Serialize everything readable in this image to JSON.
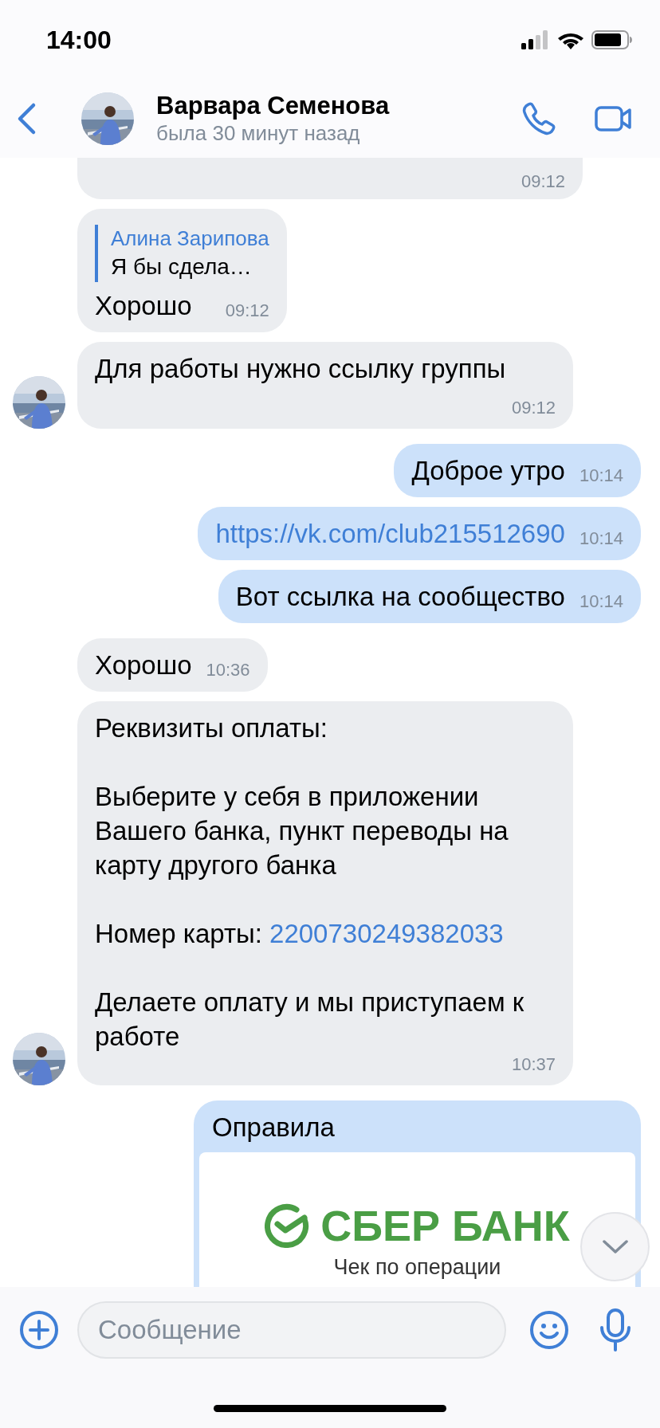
{
  "status_bar": {
    "time": "14:00"
  },
  "header": {
    "name": "Варвара Семенова",
    "status": "была 30 минут назад"
  },
  "messages": [
    {
      "outgoing": false,
      "kind": "text",
      "avatar": false,
      "time": "09:12"
    },
    {
      "outgoing": false,
      "kind": "reply",
      "avatar": false,
      "quote_author": "Алина Зарипова",
      "quote_text": "Я бы сдела…",
      "text": "Хорошо",
      "time": "09:12"
    },
    {
      "outgoing": false,
      "kind": "text",
      "avatar": true,
      "text": "Для работы нужно ссылку группы",
      "time": "09:12"
    },
    {
      "outgoing": true,
      "kind": "text",
      "text": "Доброе утро",
      "time": "10:14"
    },
    {
      "outgoing": true,
      "kind": "link",
      "text": "https://vk.com/club215512690",
      "time": "10:14"
    },
    {
      "outgoing": true,
      "kind": "text",
      "text": "Вот ссылка на сообщество",
      "time": "10:14"
    },
    {
      "outgoing": false,
      "kind": "text",
      "avatar": false,
      "text": "Хорошо",
      "time": "10:36"
    },
    {
      "outgoing": false,
      "kind": "parts",
      "avatar": true,
      "parts": [
        {
          "kind": "text",
          "text": "Реквизиты оплаты:\n\nВыберите у себя в приложении Вашего банка, пункт переводы на карту другого банка\n\nНомер карты: "
        },
        {
          "kind": "link",
          "text": "2200730249382033"
        },
        {
          "kind": "text",
          "text": "\n\nДелаете оплату и мы приступаем к работе"
        }
      ],
      "time": "10:37"
    },
    {
      "outgoing": true,
      "caption": "Оправила",
      "receipt": {
        "brand": "СБЕР БАНК",
        "title": "Чек по операции"
      }
    }
  ],
  "composer": {
    "placeholder": "Сообщение"
  }
}
